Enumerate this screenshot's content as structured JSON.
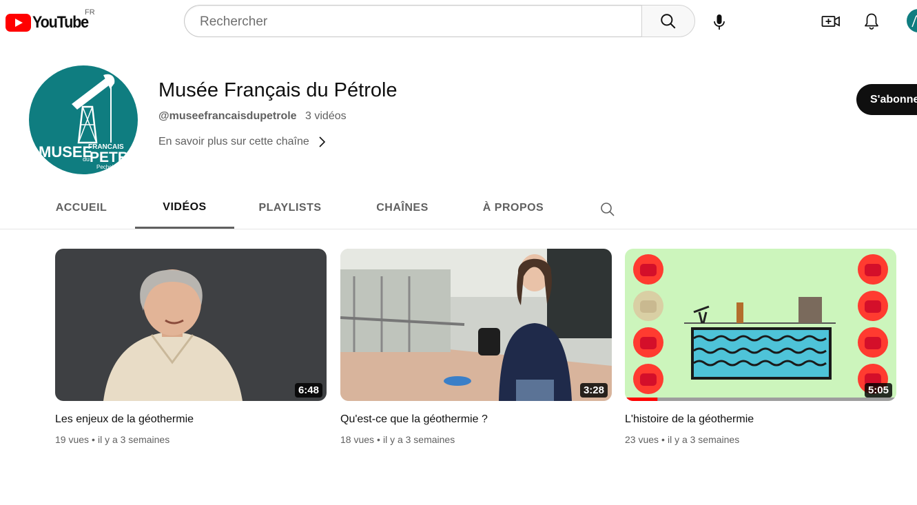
{
  "header": {
    "logo_text": "YouTube",
    "region": "FR",
    "search_placeholder": "Rechercher"
  },
  "channel": {
    "name": "Musée Français du Pétrole",
    "handle": "@museefrancaisdupetrole",
    "video_count": "3 vidéos",
    "about_link": "En savoir plus sur cette chaîne",
    "subscribe_label": "S'abonner",
    "avatar_text": {
      "line1": "MUSEE",
      "line2": "FRANCAIS",
      "line3": "du",
      "line4": "PETROLE",
      "line5": "Pechelbronn"
    }
  },
  "tabs": [
    {
      "label": "ACCUEIL",
      "active": false
    },
    {
      "label": "VIDÉOS",
      "active": true
    },
    {
      "label": "PLAYLISTS",
      "active": false
    },
    {
      "label": "CHAÎNES",
      "active": false
    },
    {
      "label": "À PROPOS",
      "active": false
    }
  ],
  "videos": [
    {
      "title": "Les enjeux de la géothermie",
      "duration": "6:48",
      "views": "19 vues",
      "age": "il y a 3 semaines",
      "watch_progress": 0
    },
    {
      "title": "Qu'est-ce que la géothermie ?",
      "duration": "3:28",
      "views": "18 vues",
      "age": "il y a 3 semaines",
      "watch_progress": 0
    },
    {
      "title": "L'histoire de la géothermie",
      "duration": "5:05",
      "views": "23 vues",
      "age": "il y a 3 semaines",
      "watch_progress": 0.12
    }
  ],
  "colors": {
    "brand_red": "#ff0000",
    "channel_teal": "#0f7d80",
    "text_primary": "#0f0f0f",
    "text_secondary": "#606060",
    "subscribe_bg": "#0f0f0f"
  },
  "icons": [
    "youtube-logo-icon",
    "search-icon",
    "mic-icon",
    "create-video-icon",
    "bell-icon",
    "chevron-right-icon"
  ]
}
